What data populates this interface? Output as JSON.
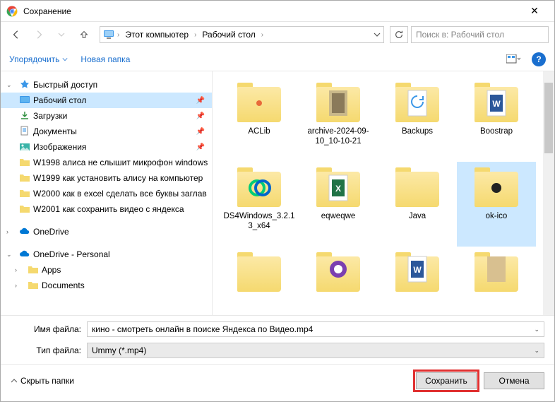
{
  "title": "Сохранение",
  "breadcrumb": {
    "root_sep": "›",
    "pc": "Этот компьютер",
    "sep": "›",
    "desktop": "Рабочий стол",
    "tail": "›"
  },
  "search_placeholder": "Поиск в: Рабочий стол",
  "toolbar": {
    "organize": "Упорядочить",
    "new_folder": "Новая папка"
  },
  "tree": {
    "quick": "Быстрый доступ",
    "desktop": "Рабочий стол",
    "downloads": "Загрузки",
    "documents": "Документы",
    "pictures": "Изображения",
    "w1998": "W1998 алиса не слышит микрофон windows",
    "w1999": "W1999 как установить алису на компьютер",
    "w2000": "W2000 как в excel сделать все буквы заглав",
    "w2001": "W2001 как сохранить видео с яндекса",
    "onedrive": "OneDrive",
    "onedrive_p": "OneDrive - Personal",
    "apps": "Apps",
    "documents2": "Documents"
  },
  "items": {
    "aclib": "ACLib",
    "archive": "archive-2024-09-10_10-10-21",
    "backups": "Backups",
    "boostrap": "Boostrap",
    "ds4": "DS4Windows_3.2.13_x64",
    "eqweqwe": "eqweqwe",
    "java": "Java",
    "okico": "ok-ico"
  },
  "fields": {
    "filename_label": "Имя файла:",
    "filename_value": "кино - смотреть онлайн в поиске Яндекса по Видео.mp4",
    "filetype_label": "Тип файла:",
    "filetype_value": "Ummy (*.mp4)"
  },
  "footer": {
    "hide": "Скрыть папки",
    "save": "Сохранить",
    "cancel": "Отмена"
  },
  "help": "?"
}
